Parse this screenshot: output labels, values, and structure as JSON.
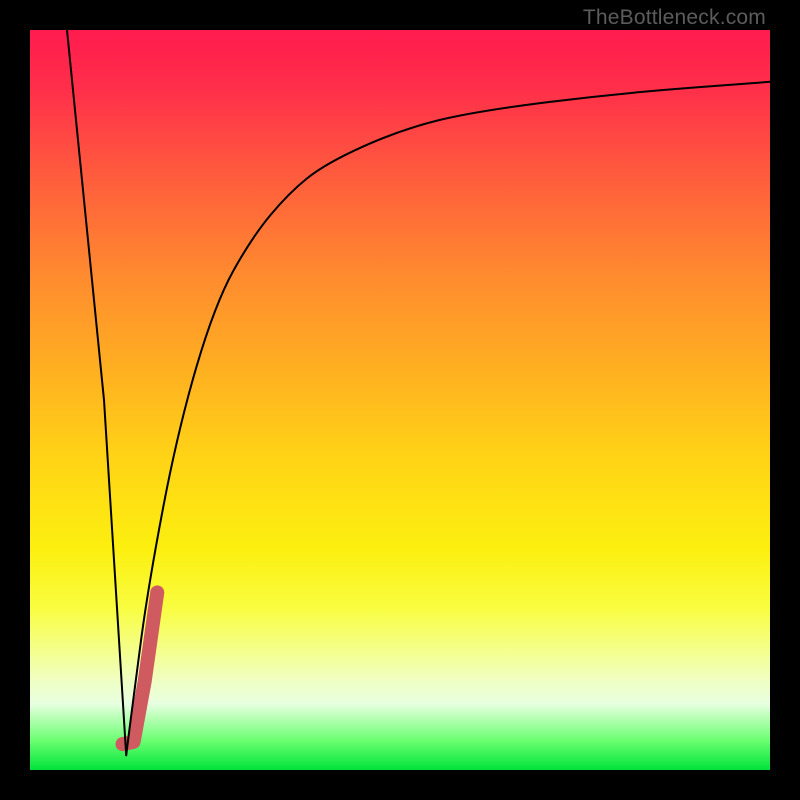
{
  "watermark": "TheBottleneck.com",
  "chart_data": {
    "type": "line",
    "title": "",
    "xlabel": "",
    "ylabel": "",
    "xlim": [
      0,
      100
    ],
    "ylim": [
      0,
      100
    ],
    "grid": false,
    "legend": false,
    "series": [
      {
        "name": "left-branch",
        "x": [
          5,
          10,
          13
        ],
        "values": [
          100,
          50,
          2
        ]
      },
      {
        "name": "right-branch",
        "x": [
          13,
          14,
          16,
          20,
          25,
          30,
          35,
          40,
          50,
          60,
          80,
          100
        ],
        "values": [
          2,
          10,
          25,
          46,
          63,
          72,
          78,
          82,
          86.5,
          89,
          91.5,
          93
        ]
      },
      {
        "name": "highlight-segment",
        "x": [
          12.5,
          14,
          15.5,
          17.2
        ],
        "values": [
          3.5,
          3.8,
          12,
          24
        ]
      }
    ],
    "colors": {
      "curve": "#000000",
      "highlight": "#cf5a5f",
      "gradient_top": "#ff1b4e",
      "gradient_mid": "#fde814",
      "gradient_bottom": "#00e43a"
    }
  }
}
